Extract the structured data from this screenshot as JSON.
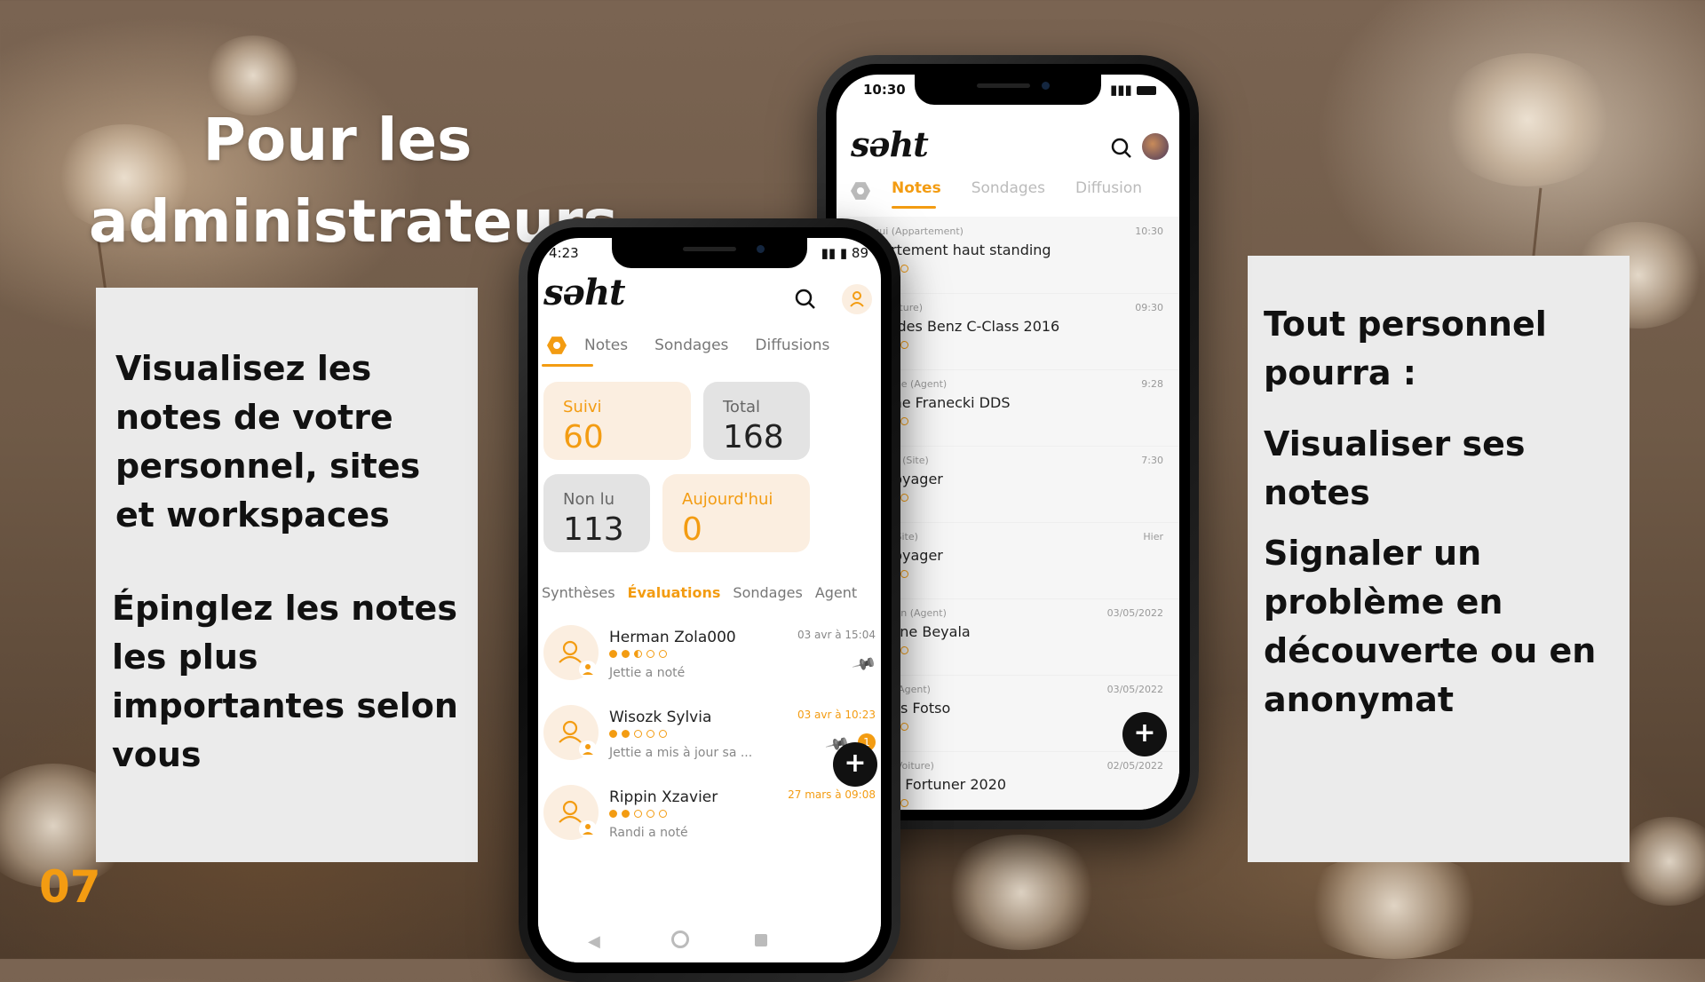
{
  "slide": {
    "title_line1": "Pour les",
    "title_line2": "administrateurs",
    "left_panel": {
      "para1": "Visualisez les notes de votre personnel, sites et workspaces",
      "para2": "Épinglez les notes les plus importantes selon vous"
    },
    "right_panel": {
      "para1": "Tout personnel pourra :",
      "para2": "Visualiser ses notes",
      "para3": "Signaler un problème en découverte ou en anonymat"
    },
    "slide_number": "07",
    "accent_color": "#f39c12"
  },
  "back_phone": {
    "status_time": "10:30",
    "logo": "səht",
    "tabs": [
      "Notes",
      "Sondages",
      "Diffusion"
    ],
    "active_tab": "Notes",
    "items": [
      {
        "meta": "Bangui (Appartement)",
        "time": "10:30",
        "title": "Appartement haut standing",
        "rating": 0
      },
      {
        "meta": "Paris (Voiture)",
        "time": "09:30",
        "title": "Mercedes Benz C-Class 2016",
        "rating": 4
      },
      {
        "meta": "Brazzaville (Agent)",
        "time": "9:28",
        "title": "Megane Franecki DDS",
        "rating": 3
      },
      {
        "meta": "Bruxelles (Site)",
        "time": "7:30",
        "title": "Bus Voyager",
        "rating": 4
      },
      {
        "meta": "Douala (Site)",
        "time": "Hier",
        "title": "Bus Voyager",
        "rating": 4
      },
      {
        "meta": "Cape Town (Agent)",
        "time": "03/05/2022",
        "title": "Sandrine Beyala",
        "rating": 4
      },
      {
        "meta": "Abidjan (Agent)",
        "time": "03/05/2022",
        "title": "Charles Fotso",
        "rating": 4
      },
      {
        "meta": "Nairobi (Voiture)",
        "time": "02/05/2022",
        "title": "Toyota Fortuner 2020",
        "rating": 0
      }
    ],
    "fab_label": "+"
  },
  "front_phone": {
    "status_time": "4:23",
    "status_battery": "89",
    "logo": "səht",
    "tabs": [
      "Notes",
      "Sondages",
      "Diffusions"
    ],
    "stats": [
      {
        "label": "Suivi",
        "value": "60"
      },
      {
        "label": "Total",
        "value": "168"
      },
      {
        "label": "Non lu",
        "value": "113"
      },
      {
        "label": "Aujourd'hui",
        "value": "0"
      }
    ],
    "subtabs": [
      "Synthèses",
      "Évaluations",
      "Sondages",
      "Agent"
    ],
    "active_subtab": "Évaluations",
    "items": [
      {
        "name": "Herman Zola000",
        "date": "03 avr à 15:04",
        "sub": "Jettie a noté",
        "rating": 2.5,
        "badge": ""
      },
      {
        "name": "Wisozk Sylvia",
        "date": "03 avr à 10:23",
        "sub": "Jettie a mis à jour sa ...",
        "rating": 2,
        "badge": "1"
      },
      {
        "name": "Rippin Xzavier",
        "date": "27 mars à 09:08",
        "sub": "Randi a noté",
        "rating": 2,
        "badge": ""
      }
    ],
    "fab_label": "+"
  }
}
